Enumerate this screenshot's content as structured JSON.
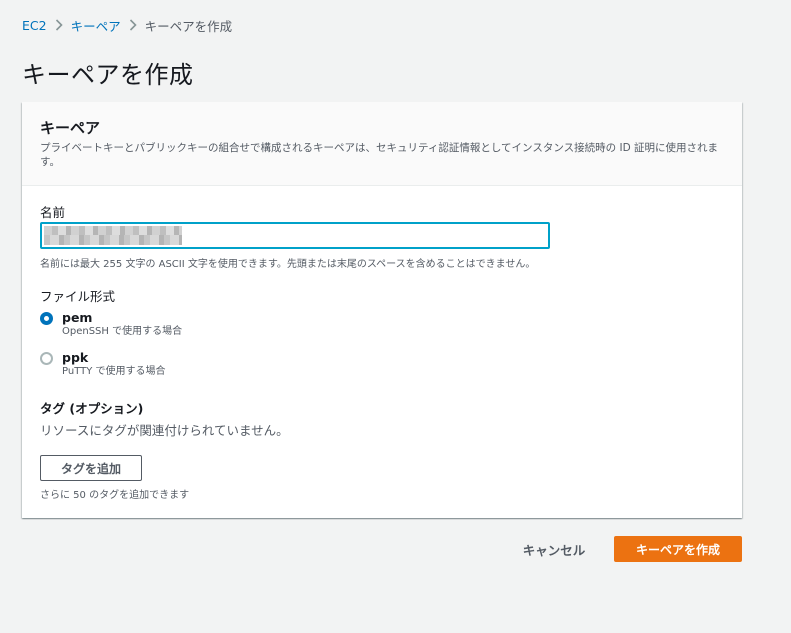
{
  "breadcrumb": {
    "items": [
      {
        "label": "EC2"
      },
      {
        "label": "キーペア"
      },
      {
        "label": "キーペアを作成"
      }
    ]
  },
  "page_title": "キーペアを作成",
  "container": {
    "title": "キーペア",
    "description": "プライベートキーとパブリックキーの組合せで構成されるキーペアは、セキュリティ認証情報としてインスタンス接続時の ID 証明に使用されます。"
  },
  "name_field": {
    "label": "名前",
    "value": "",
    "hint": "名前には最大 255 文字の ASCII 文字を使用できます。先頭または末尾のスペースを含めることはできません。"
  },
  "file_format": {
    "label": "ファイル形式",
    "options": [
      {
        "title": "pem",
        "description": "OpenSSH で使用する場合",
        "checked": true
      },
      {
        "title": "ppk",
        "description": "PuTTY で使用する場合",
        "checked": false
      }
    ]
  },
  "tags": {
    "label": "タグ (オプション)",
    "empty_text": "リソースにタグが関連付けられていません。",
    "add_button": "タグを追加",
    "hint": "さらに 50 のタグを追加できます"
  },
  "actions": {
    "cancel": "キャンセル",
    "create": "キーペアを作成"
  },
  "colors": {
    "link": "#0073bb",
    "primary_button": "#ec7211",
    "focus_border": "#00a1c9",
    "background": "#f2f3f3"
  }
}
